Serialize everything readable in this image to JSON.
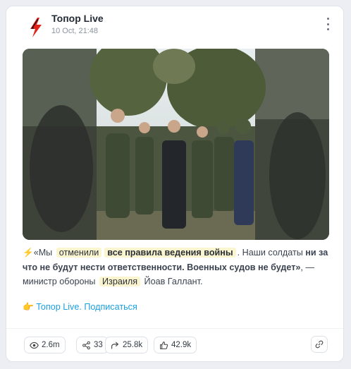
{
  "channel": {
    "name": "Топор Live",
    "date": "10 Oct, 21:48",
    "logo_color": "#e2231a"
  },
  "post": {
    "emoji": "⚡",
    "t1": "«Мы ",
    "h1": "отменили",
    "h2": "все правила ведения войны",
    "t2": ". Наши солдаты ",
    "b1": "ни за что не будут нести ответственности. Военных судов не будет»",
    "t3": ", — министр обороны ",
    "h3": "Израиля",
    "t4": " Йоав Галлант.",
    "link_emoji": "👉",
    "link_text": "Топор Live. Подписаться"
  },
  "stats": {
    "views": "2.6m",
    "shares": "33",
    "forwards": "25.8k",
    "likes": "42.9k"
  },
  "colors": {
    "accent_link": "#1aa0e0",
    "highlight": "#fbf5cf"
  }
}
